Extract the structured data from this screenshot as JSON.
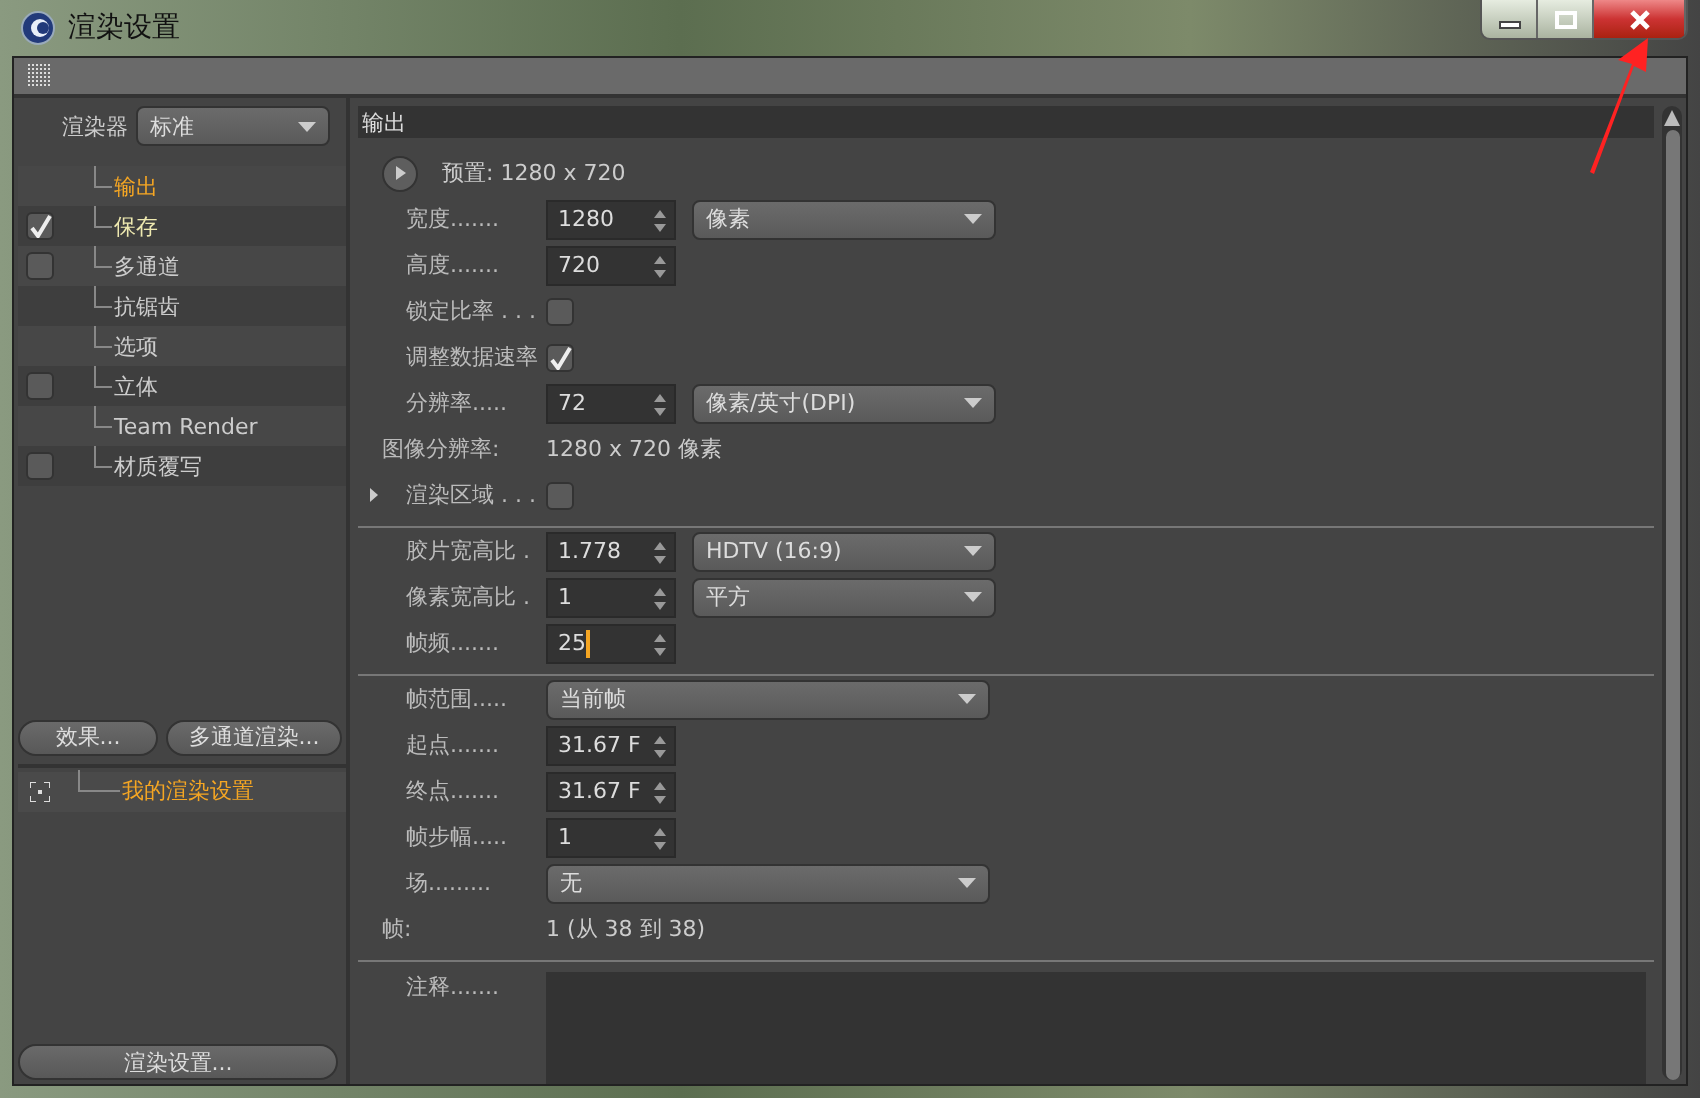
{
  "window": {
    "title": "渲染设置"
  },
  "renderer": {
    "label": "渲染器",
    "value": "标准"
  },
  "tree": [
    {
      "label": "输出",
      "kind": "plain",
      "selected": true
    },
    {
      "label": "保存",
      "kind": "check",
      "checked": true,
      "selected": false
    },
    {
      "label": "多通道",
      "kind": "check",
      "checked": false,
      "selected": false
    },
    {
      "label": "抗锯齿",
      "kind": "plain",
      "selected": false
    },
    {
      "label": "选项",
      "kind": "plain",
      "selected": false
    },
    {
      "label": "立体",
      "kind": "check",
      "checked": false,
      "selected": false
    },
    {
      "label": "Team Render",
      "kind": "plain",
      "selected": false
    },
    {
      "label": "材质覆写",
      "kind": "check",
      "checked": false,
      "selected": false
    }
  ],
  "left_buttons": [
    "效果...",
    "多通道渲染..."
  ],
  "settings_list": [
    {
      "label": "我的渲染设置",
      "selected": true
    }
  ],
  "bottom_button": "渲染设置...",
  "section_title": "输出",
  "groups": [
    {
      "rows": [
        {
          "kind": "preset",
          "label": "预置: 1280 x 720"
        },
        {
          "kind": "number",
          "label": "宽度.......",
          "value": "1280",
          "unit": "像素"
        },
        {
          "kind": "number",
          "label": "高度.......",
          "value": "720"
        },
        {
          "kind": "checkbox",
          "label": "锁定比率 . . .",
          "checked": false
        },
        {
          "kind": "checkbox",
          "label": "调整数据速率",
          "checked": true
        },
        {
          "kind": "number",
          "label": "分辨率.....",
          "value": "72",
          "unit": "像素/英寸(DPI)"
        },
        {
          "kind": "info",
          "label": "图像分辨率:",
          "value": "1280 x 720 像素"
        },
        {
          "kind": "expander",
          "label": "渲染区域 . . .",
          "checked": false,
          "expanded": false
        }
      ]
    },
    {
      "rows": [
        {
          "kind": "number",
          "label": "胶片宽高比 .",
          "value": "1.778",
          "unit": "HDTV (16:9)"
        },
        {
          "kind": "number",
          "label": "像素宽高比 .",
          "value": "1",
          "unit": "平方"
        },
        {
          "kind": "number",
          "label": "帧频.......",
          "value": "25",
          "focused": true
        }
      ]
    },
    {
      "rows": [
        {
          "kind": "dropdown",
          "label": "帧范围.....",
          "value": "当前帧"
        },
        {
          "kind": "number",
          "label": "起点.......",
          "value": "31.67 F"
        },
        {
          "kind": "number",
          "label": "终点.......",
          "value": "31.67 F"
        },
        {
          "kind": "number",
          "label": "帧步幅.....",
          "value": "1"
        },
        {
          "kind": "dropdown",
          "label": "场.........",
          "value": "无"
        },
        {
          "kind": "info",
          "label": "帧:",
          "value": "1 (从 38 到 38)"
        }
      ]
    },
    {
      "rows": [
        {
          "kind": "notes",
          "label": "注释......."
        }
      ]
    }
  ]
}
